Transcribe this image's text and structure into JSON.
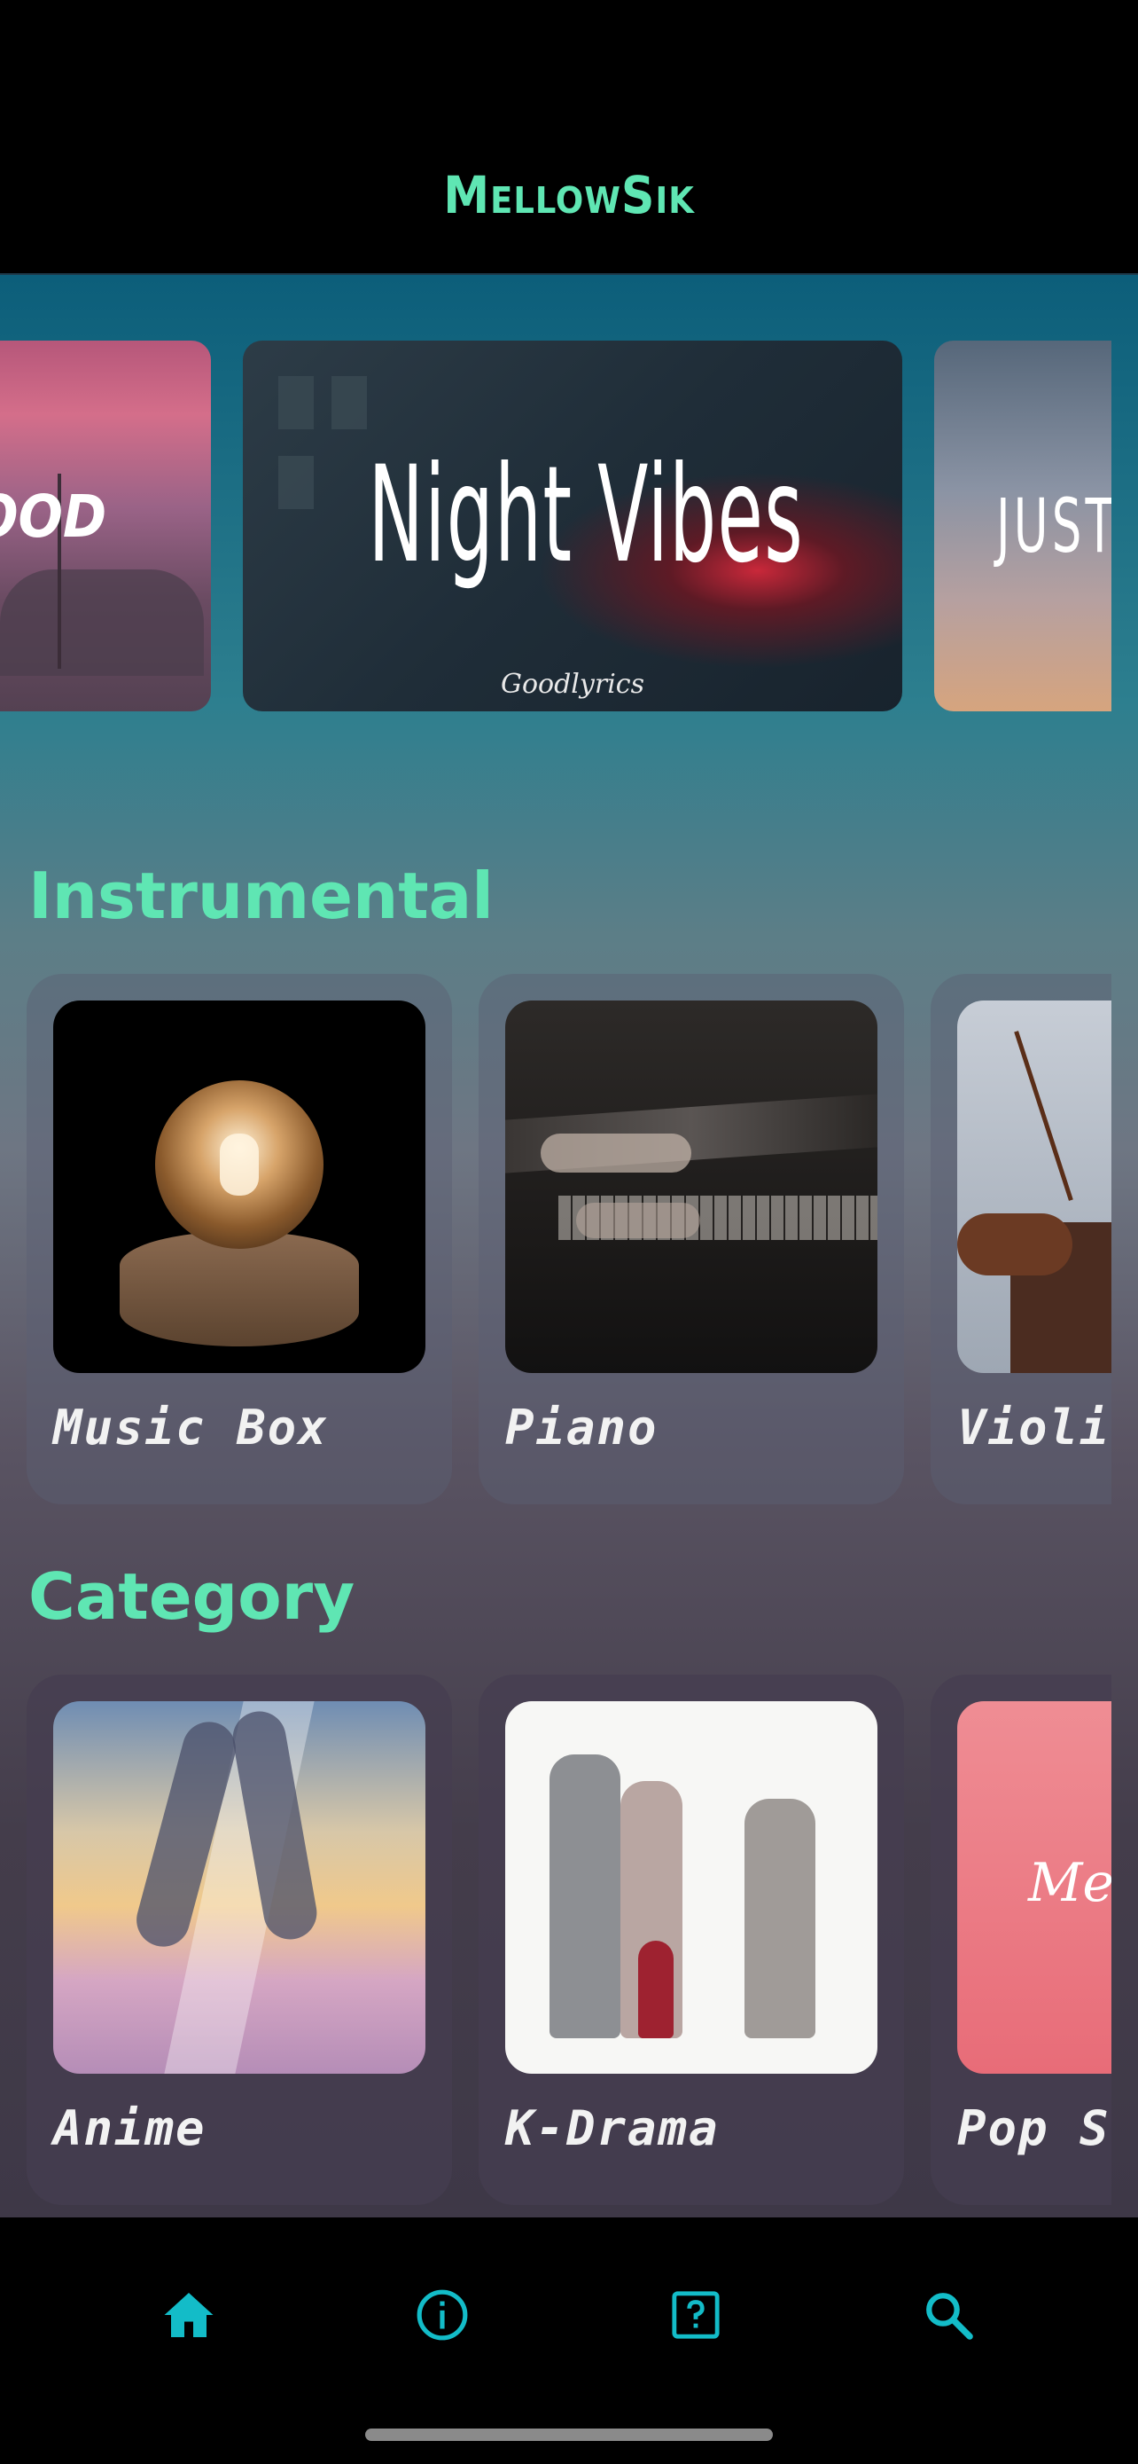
{
  "app": {
    "title": "MellowSik"
  },
  "carousel": {
    "banners": [
      {
        "text": "OOD",
        "subtext": ""
      },
      {
        "text": "Night Vibes",
        "subtext": "Goodlyrics"
      },
      {
        "text": "JUST",
        "subtext": ""
      }
    ]
  },
  "sections": {
    "instrumental": {
      "title": "Instrumental",
      "cards": [
        {
          "label": "Music Box"
        },
        {
          "label": "Piano"
        },
        {
          "label": "Violin"
        }
      ]
    },
    "category": {
      "title": "Category",
      "cards": [
        {
          "label": "Anime"
        },
        {
          "label": "K-Drama"
        },
        {
          "label": "Pop Songs"
        }
      ],
      "pop_image_text": "Me"
    }
  },
  "tabbar": {
    "accent_color": "#13bcc8",
    "items": [
      {
        "icon": "home-icon",
        "active": true
      },
      {
        "icon": "info-icon",
        "active": false
      },
      {
        "icon": "help-icon",
        "active": false
      },
      {
        "icon": "search-icon",
        "active": false
      }
    ]
  },
  "colors": {
    "title": "#5fe6b3",
    "accent": "#13bcc8",
    "header_bg": "#000000"
  }
}
